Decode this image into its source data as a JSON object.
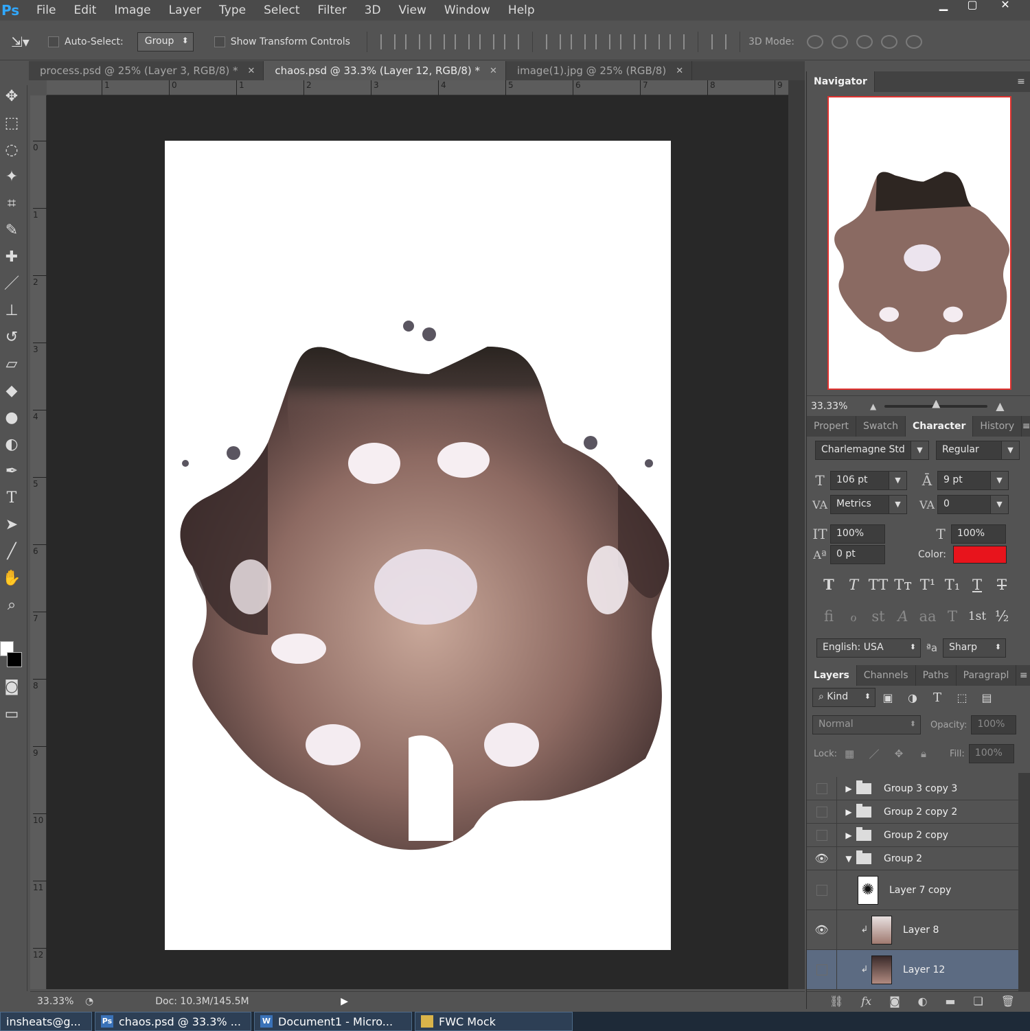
{
  "app": {
    "logo": "Ps"
  },
  "menu": [
    "File",
    "Edit",
    "Image",
    "Layer",
    "Type",
    "Select",
    "Filter",
    "3D",
    "View",
    "Window",
    "Help"
  ],
  "window_controls": {
    "minimize": "▁",
    "maximize": "▢",
    "close": "✕"
  },
  "options_bar": {
    "auto_select_label": "Auto-Select:",
    "auto_select_value": "Group",
    "show_transform_label": "Show Transform Controls",
    "mode_3d_label": "3D Mode:"
  },
  "tabs": [
    {
      "label": "process.psd @ 25% (Layer 3, RGB/8) *",
      "active": false
    },
    {
      "label": "chaos.psd @ 33.3% (Layer 12, RGB/8) *",
      "active": true
    },
    {
      "label": "image(1).jpg @ 25% (RGB/8)",
      "active": false
    }
  ],
  "ruler_top": [
    "1",
    "0",
    "1",
    "2",
    "3",
    "4",
    "5",
    "6",
    "7",
    "8",
    "9"
  ],
  "ruler_left": [
    "0",
    "1",
    "2",
    "3",
    "4",
    "5",
    "6",
    "7",
    "8",
    "9",
    "10",
    "11",
    "12"
  ],
  "status": {
    "zoom": "33.33%",
    "doc": "Doc: 10.3M/145.5M"
  },
  "navigator": {
    "tab": "Navigator",
    "zoom": "33.33%",
    "zoom_fraction": 0.5
  },
  "character_panel": {
    "tabs": [
      "Propert",
      "Swatch",
      "Character",
      "History"
    ],
    "active_tab": "Character",
    "font_family": "Charlemagne Std",
    "font_style": "Regular",
    "size": "106 pt",
    "leading": "9 pt",
    "kerning": "Metrics",
    "tracking": "0",
    "vertical_scale": "100%",
    "horizontal_scale": "100%",
    "baseline_shift": "0 pt",
    "color_label": "Color:",
    "color": "#e8141c",
    "language": "English: USA",
    "aa_label": "ªa",
    "antialias": "Sharp",
    "glyphs_row1": [
      "T",
      "T",
      "TT",
      "Tт",
      "T¹",
      "T₁",
      "T",
      "T"
    ],
    "glyphs_row2": [
      "ﬁ",
      "ℴ",
      "st",
      "A",
      "aa",
      "T",
      "1st",
      "½"
    ]
  },
  "layers_panel": {
    "tabs": [
      "Layers",
      "Channels",
      "Paths",
      "Paragrapl"
    ],
    "active_tab": "Layers",
    "filter_kind": "Kind",
    "blend_mode": "Normal",
    "opacity_label": "Opacity:",
    "opacity": "100%",
    "lock_label": "Lock:",
    "fill_label": "Fill:",
    "fill": "100%",
    "layers": [
      {
        "name": "Group 3 copy 3",
        "type": "group",
        "visible": false,
        "expanded": false
      },
      {
        "name": "Group 2 copy 2",
        "type": "group",
        "visible": false,
        "expanded": false
      },
      {
        "name": "Group 2 copy",
        "type": "group",
        "visible": false,
        "expanded": false
      },
      {
        "name": "Group 2",
        "type": "group",
        "visible": true,
        "expanded": true
      },
      {
        "name": "Layer 7 copy",
        "type": "layer",
        "visible": false,
        "clipped": false
      },
      {
        "name": "Layer 8",
        "type": "layer",
        "visible": true,
        "clipped": true
      },
      {
        "name": "Layer 12",
        "type": "layer",
        "visible": false,
        "clipped": true,
        "selected": true
      }
    ]
  },
  "taskbar": [
    {
      "label": "insheats@g...",
      "icon": ""
    },
    {
      "label": "chaos.psd @ 33.3% ...",
      "icon": "Ps"
    },
    {
      "label": "Document1 - Micro...",
      "icon": "W"
    },
    {
      "label": "FWC Mock",
      "icon": "▮"
    }
  ]
}
